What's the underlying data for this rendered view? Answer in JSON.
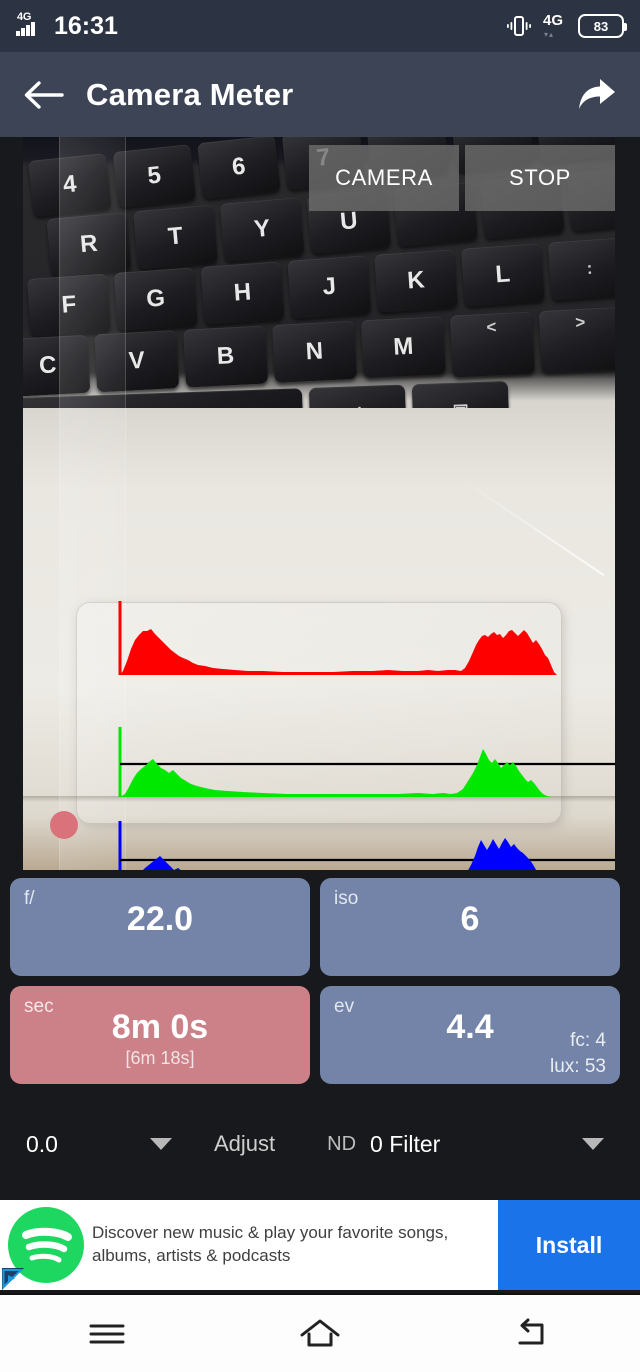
{
  "status_bar": {
    "network_label": "4G",
    "time": "16:31",
    "data_network": "4G",
    "battery_percent": "83",
    "icons": {
      "signal": "signal-bars-icon",
      "vibrate": "vibrate-icon",
      "battery": "battery-icon"
    }
  },
  "app_bar": {
    "title": "Camera Meter",
    "back_icon": "arrow-left-icon",
    "share_icon": "share-arrow-icon"
  },
  "preview": {
    "camera_button": "CAMERA",
    "stop_button": "STOP",
    "record_indicator": "record-dot",
    "keys_row1": [
      "4",
      "5",
      "6",
      "7"
    ],
    "keys_row2": [
      "R",
      "T",
      "Y",
      "U"
    ],
    "keys_row3": [
      "F",
      "G",
      "H",
      "J",
      "K",
      "L",
      ":"
    ],
    "keys_row4": [
      "C",
      "V",
      "B",
      "N",
      "M",
      "<",
      ">"
    ],
    "keys_row5": [
      "alt",
      "menu"
    ]
  },
  "histogram": {
    "channels": [
      "red",
      "green",
      "blue"
    ],
    "colors": {
      "red": "#ff0000",
      "green": "#00e800",
      "blue": "#0000ff"
    },
    "reference_line_color": "#000000"
  },
  "cards": [
    {
      "label": "f/",
      "value": "22.0",
      "sub": "",
      "corner1": "",
      "corner2": "",
      "color": "#7384a8"
    },
    {
      "label": "iso",
      "value": "6",
      "sub": "",
      "corner1": "",
      "corner2": "",
      "color": "#7384a8"
    },
    {
      "label": "sec",
      "value": "8m 0s",
      "sub": "[6m 18s]",
      "corner1": "",
      "corner2": "",
      "color": "#cc8189"
    },
    {
      "label": "ev",
      "value": "4.4",
      "sub": "",
      "corner1": "fc: 4",
      "corner2": "lux: 53",
      "color": "#7384a8"
    }
  ],
  "adjust_row": {
    "ev_value": "0.0",
    "adjust_label": "Adjust",
    "nd_label": "ND",
    "filter_value": "0 Filter",
    "caret_icon": "chevron-down-icon"
  },
  "ad": {
    "advertiser_logo": "spotify-logo-icon",
    "adchoices_icon": "adchoices-icon",
    "body": "Discover new music & play your favorite songs, albums, artists & podcasts",
    "cta": "Install",
    "cta_color": "#1a73e8"
  },
  "nav_bar": {
    "menu_icon": "menu-icon",
    "home_icon": "home-icon",
    "back_icon": "back-icon"
  }
}
